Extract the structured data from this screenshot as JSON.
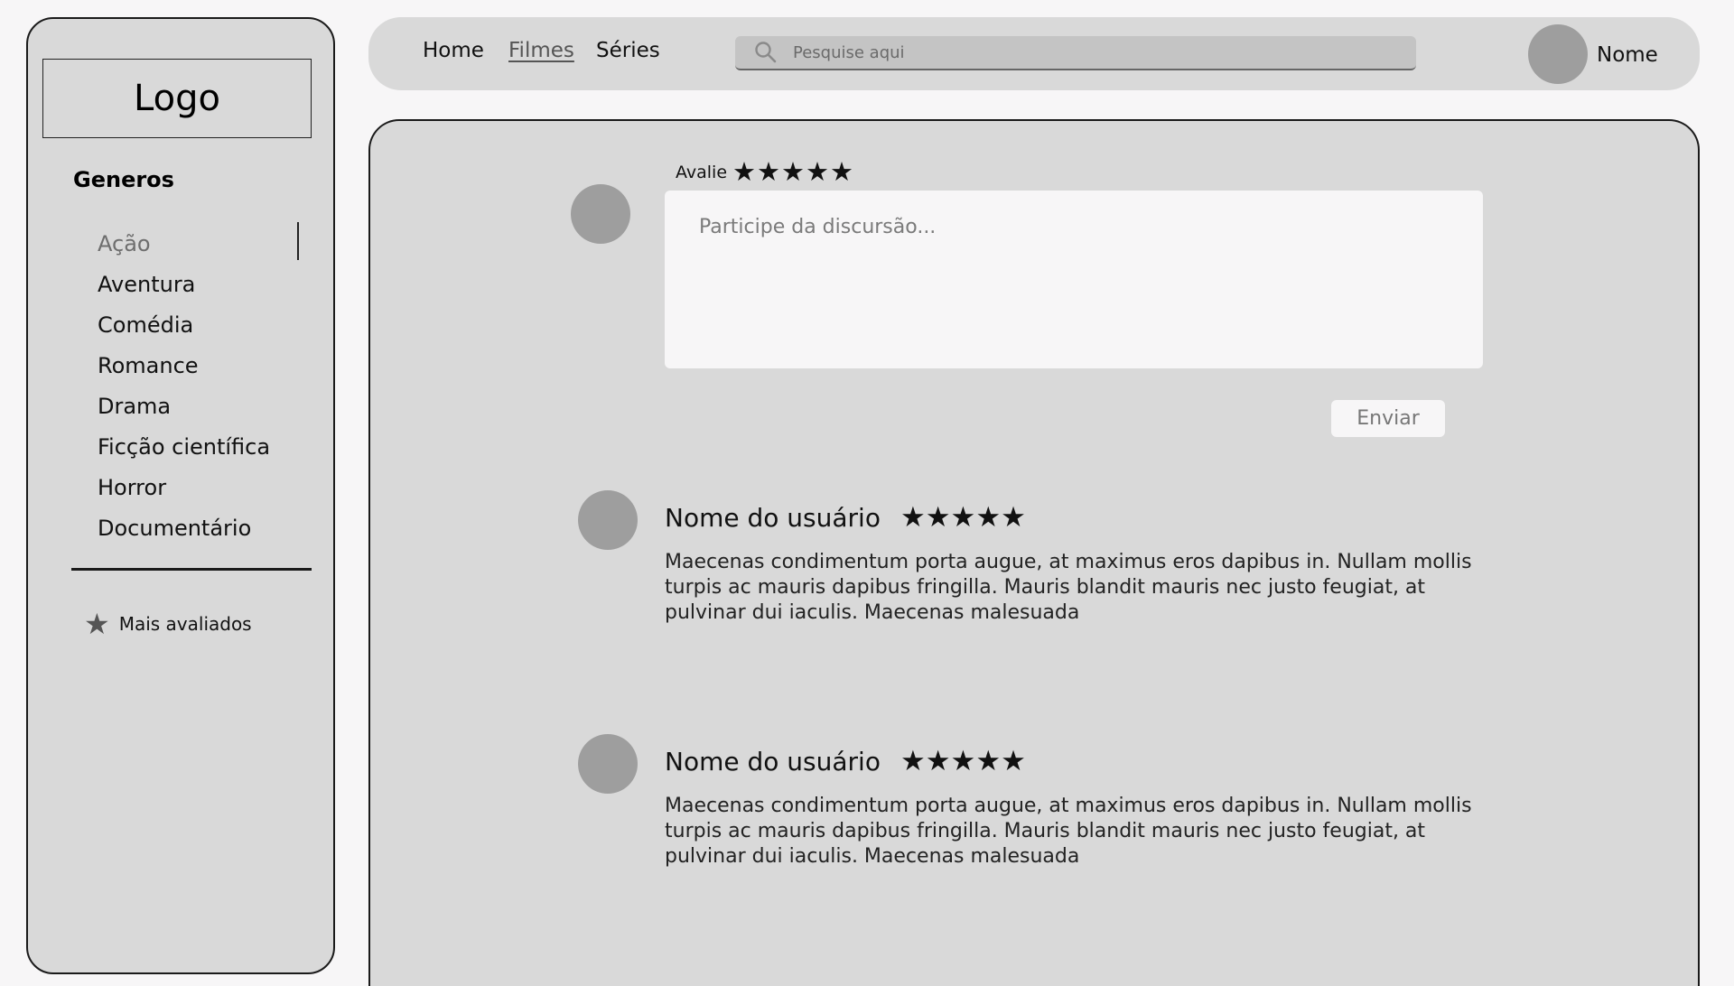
{
  "sidebar": {
    "logo": "Logo",
    "genres_title": "Generos",
    "genres": [
      {
        "label": "Ação",
        "active": true
      },
      {
        "label": "Aventura"
      },
      {
        "label": "Comédia"
      },
      {
        "label": "Romance"
      },
      {
        "label": "Drama"
      },
      {
        "label": "Ficção científica"
      },
      {
        "label": "Horror"
      },
      {
        "label": "Documentário"
      }
    ],
    "top_rated": {
      "icon": "star-icon",
      "label": "Mais avaliados"
    }
  },
  "header": {
    "nav": [
      {
        "label": "Home"
      },
      {
        "label": "Filmes",
        "active": true
      },
      {
        "label": "Séries"
      }
    ],
    "search": {
      "icon": "search-icon",
      "placeholder": "Pesquise aqui"
    },
    "user": {
      "name": "Nome"
    }
  },
  "composer": {
    "rate_label": "Avalie",
    "stars": [
      "★",
      "★",
      "★",
      "★",
      "★"
    ],
    "placeholder": "Participe da discursão...",
    "send_label": "Enviar"
  },
  "comments": [
    {
      "user": "Nome do usuário",
      "stars": "★★★★★",
      "rating": 5,
      "text": "Maecenas condimentum porta augue, at maximus eros dapibus in. Nullam mollis turpis ac mauris dapibus fringilla. Mauris blandit mauris nec justo feugiat, at pulvinar dui iaculis. Maecenas malesuada"
    },
    {
      "user": "Nome do usuário",
      "stars": "★★★★★",
      "rating": 5,
      "text": "Maecenas condimentum porta augue, at maximus eros dapibus in. Nullam mollis turpis ac mauris dapibus fringilla. Mauris blandit mauris nec justo feugiat, at pulvinar dui iaculis. Maecenas malesuada"
    }
  ],
  "colors": {
    "page_background": "#f7f6f7",
    "panel": "#d9d9d9",
    "avatar": "#9e9e9e",
    "search_field": "#c4c4c4"
  }
}
